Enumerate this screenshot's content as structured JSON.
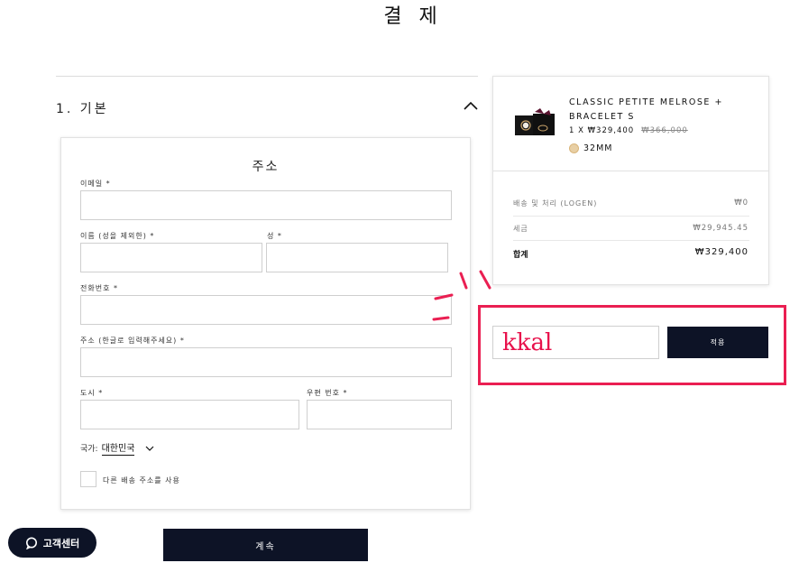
{
  "page": {
    "title": "결 제"
  },
  "step": {
    "heading": "1. 기본"
  },
  "address_form": {
    "title": "주소",
    "email_label": "이메일 *",
    "first_name_label": "이름 (성을 제외한) *",
    "last_name_label": "성 *",
    "phone_label": "전화번호 *",
    "address_label": "주소 (한글로 입력해주세요) *",
    "city_label": "도시 *",
    "postal_label": "우편 번호 *",
    "country_label": "국가:",
    "country_value": "대한민국",
    "alt_shipping_label": "다른 배송 주소를 사용"
  },
  "actions": {
    "continue_label": "계속"
  },
  "support": {
    "label": "고객센터"
  },
  "order_summary": {
    "product_name": "CLASSIC PETITE MELROSE + BRACELET S",
    "quantity_price": "1 X ₩329,400",
    "original_price": "₩366,000",
    "size": "32MM",
    "shipping_label": "배송 및 처리 (LOGEN)",
    "shipping_value": "₩0",
    "tax_label": "세금",
    "tax_value": "₩29,945.45",
    "total_label": "합계",
    "total_value": "₩329,400"
  },
  "promo": {
    "code_value": "kkal",
    "apply_label": "적용"
  },
  "colors": {
    "dark_navy": "#0d1326",
    "highlight_red": "#ea1f52",
    "swatch_gold": "#e8cfa4"
  }
}
